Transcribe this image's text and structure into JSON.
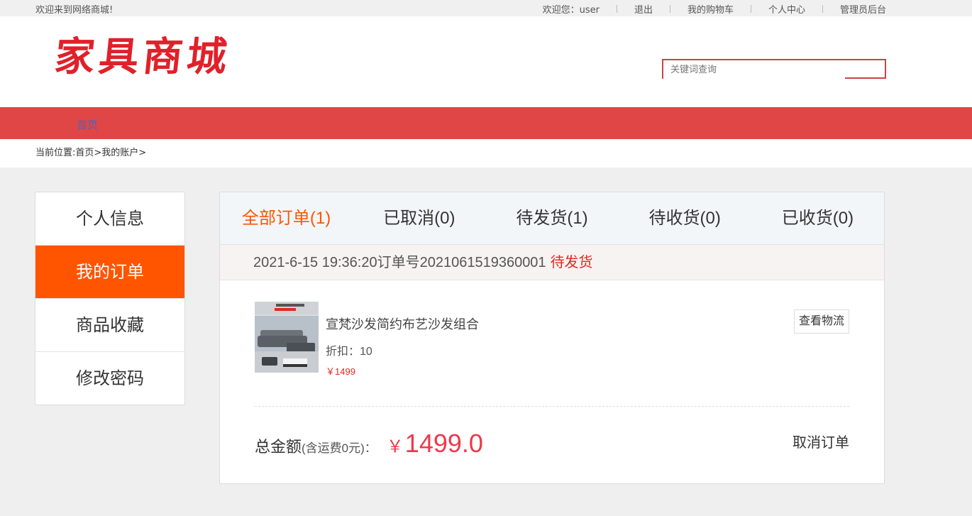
{
  "topbar": {
    "welcome": "欢迎来到网络商城!",
    "user_greeting": "欢迎您：user",
    "logout": "退出",
    "cart": "我的购物车",
    "profile": "个人中心",
    "admin": "管理员后台"
  },
  "header": {
    "logo": "家具商城",
    "search_placeholder": "关键词查询"
  },
  "nav": {
    "home": "首页"
  },
  "breadcrumb": {
    "label": "当前位置:",
    "path": "首页>我的账户>"
  },
  "sidebar": {
    "items": [
      {
        "label": "个人信息",
        "active": false
      },
      {
        "label": "我的订单",
        "active": true
      },
      {
        "label": "商品收藏",
        "active": false
      },
      {
        "label": "修改密码",
        "active": false
      }
    ]
  },
  "tabs": [
    {
      "label": "全部订单(1)",
      "active": true
    },
    {
      "label": "已取消(0)",
      "active": false
    },
    {
      "label": "待发货(1)",
      "active": false
    },
    {
      "label": "待收货(0)",
      "active": false
    },
    {
      "label": "已收货(0)",
      "active": false
    }
  ],
  "order": {
    "header": "2021-6-15 19:36:20订单号2021061519360001",
    "status": "待发货",
    "product_name": "宣梵沙发简约布艺沙发组合",
    "discount": "折扣：10",
    "price": "￥1499",
    "logistics_button": "查看物流",
    "total_label": "总金额",
    "total_sub": "(含运费0元)：",
    "total_currency": "￥",
    "total_amount": "1499.0",
    "cancel_button": "取消订单"
  },
  "colors": {
    "accent": "#ff5500",
    "nav": "#e04646",
    "price": "#f0384a",
    "status": "#e4281f"
  }
}
